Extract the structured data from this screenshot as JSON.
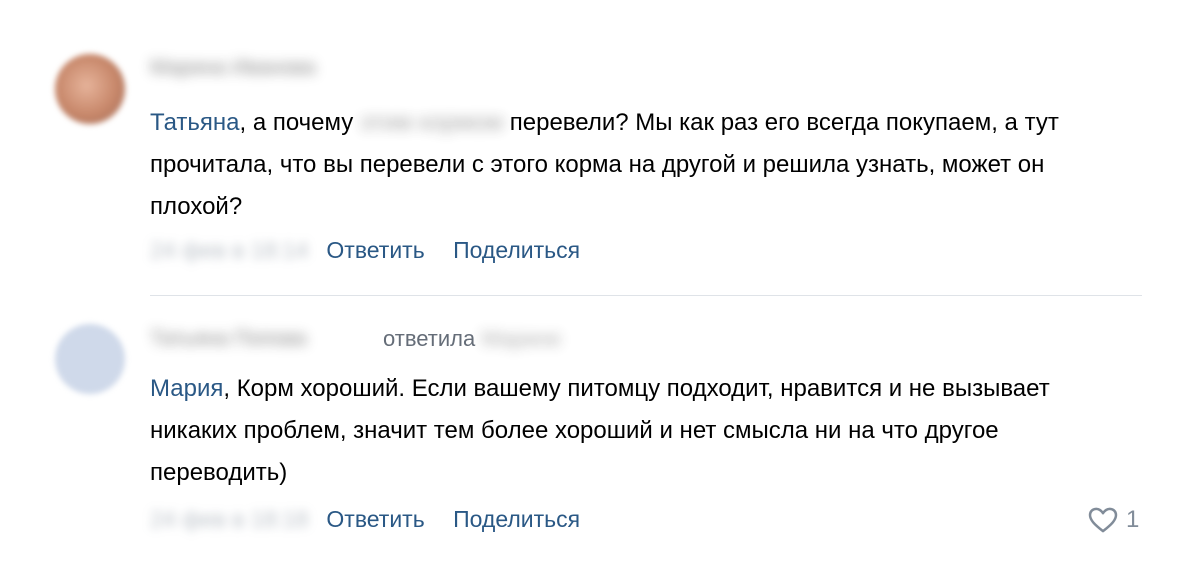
{
  "comments": [
    {
      "author": "Марина Иванова",
      "mention": "Татьяна",
      "text_part1": ", а почему ",
      "hidden_word": "этим кормом",
      "text_part2": " перевели? Мы как раз его всегда покупаем, а тут прочитала, что вы перевели с этого корма на другой и решила узнать, может он плохой?",
      "date": "24 фев в 18:14",
      "reply_label": "Ответить",
      "share_label": "Поделиться"
    },
    {
      "author": "Татьяна Попова",
      "reply_to_label": "ответила",
      "reply_to_name": "Марине",
      "mention": "Мария",
      "text": ", Корм хороший. Если вашему питомцу подходит, нравится и не вызывает никаких проблем, значит тем более хороший и нет смысла ни на что другое переводить)",
      "date": "24 фев в 18:18",
      "reply_label": "Ответить",
      "share_label": "Поделиться",
      "likes": "1"
    }
  ],
  "icons": {
    "like": "heart-outline-icon"
  },
  "colors": {
    "link": "#2a5885",
    "muted": "#818c99",
    "divider": "#dfe3e8"
  }
}
